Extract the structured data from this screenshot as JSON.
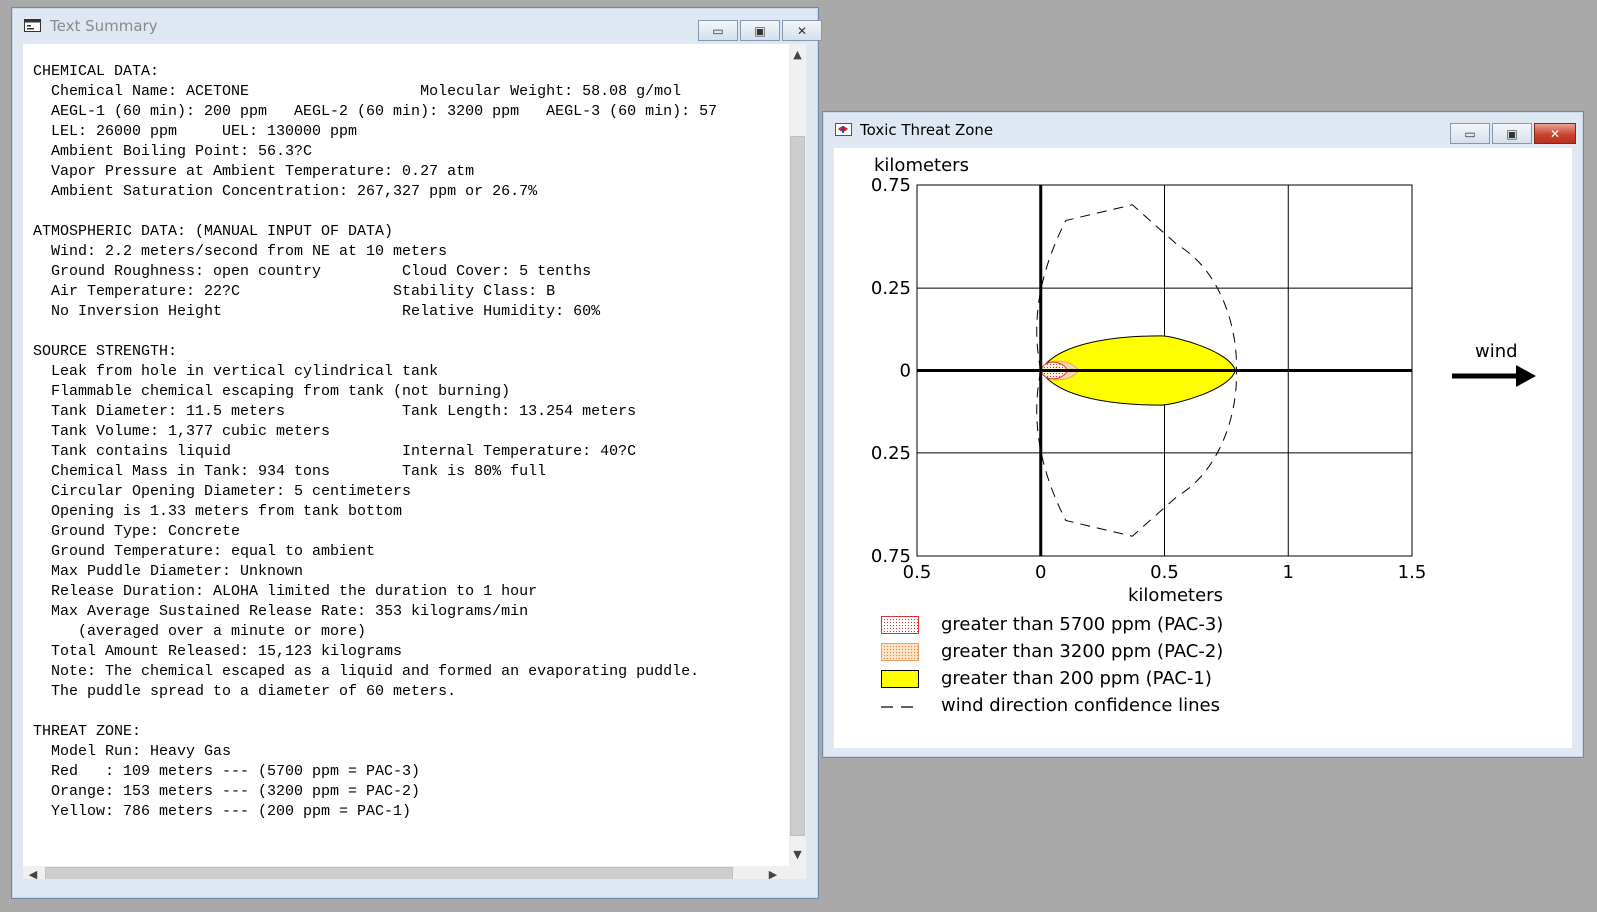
{
  "text_window": {
    "title": "Text Summary",
    "lines": [
      "CHEMICAL DATA:",
      "  Chemical Name: ACETONE                   Molecular Weight: 58.08 g/mol",
      "  AEGL-1 (60 min): 200 ppm   AEGL-2 (60 min): 3200 ppm   AEGL-3 (60 min): 57",
      "  LEL: 26000 ppm     UEL: 130000 ppm",
      "  Ambient Boiling Point: 56.3?C",
      "  Vapor Pressure at Ambient Temperature: 0.27 atm",
      "  Ambient Saturation Concentration: 267,327 ppm or 26.7%",
      "",
      "ATMOSPHERIC DATA: (MANUAL INPUT OF DATA)",
      "  Wind: 2.2 meters/second from NE at 10 meters",
      "  Ground Roughness: open country         Cloud Cover: 5 tenths",
      "  Air Temperature: 22?C                 Stability Class: B",
      "  No Inversion Height                    Relative Humidity: 60%",
      "",
      "SOURCE STRENGTH:",
      "  Leak from hole in vertical cylindrical tank",
      "  Flammable chemical escaping from tank (not burning)",
      "  Tank Diameter: 11.5 meters             Tank Length: 13.254 meters",
      "  Tank Volume: 1,377 cubic meters",
      "  Tank contains liquid                   Internal Temperature: 40?C",
      "  Chemical Mass in Tank: 934 tons        Tank is 80% full",
      "  Circular Opening Diameter: 5 centimeters",
      "  Opening is 1.33 meters from tank bottom",
      "  Ground Type: Concrete",
      "  Ground Temperature: equal to ambient",
      "  Max Puddle Diameter: Unknown",
      "  Release Duration: ALOHA limited the duration to 1 hour",
      "  Max Average Sustained Release Rate: 353 kilograms/min",
      "     (averaged over a minute or more)",
      "  Total Amount Released: 15,123 kilograms",
      "  Note: The chemical escaped as a liquid and formed an evaporating puddle.",
      "  The puddle spread to a diameter of 60 meters.",
      "",
      "THREAT ZONE:",
      "  Model Run: Heavy Gas",
      "  Red   : 109 meters --- (5700 ppm = PAC-3)",
      "  Orange: 153 meters --- (3200 ppm = PAC-2)",
      "  Yellow: 786 meters --- (200 ppm = PAC-1)"
    ]
  },
  "plot_window": {
    "title": "Toxic Threat Zone",
    "wind_label": "wind",
    "legend": [
      {
        "label": "greater than 5700 ppm (PAC-3)",
        "color": "#e03030"
      },
      {
        "label": "greater than 3200 ppm (PAC-2)",
        "color": "#f0a060"
      },
      {
        "label": "greater than 200 ppm (PAC-1)",
        "color": "#ffff00"
      },
      {
        "label": "wind direction confidence lines",
        "color": "#000000"
      }
    ]
  },
  "chart_data": {
    "type": "area",
    "xlabel": "kilometers",
    "ylabel": "kilometers",
    "x_ticks": [
      "0.5",
      "0",
      "0.5",
      "1",
      "1.5"
    ],
    "y_ticks": [
      "0.75",
      "0.25",
      "0",
      "0.25",
      "0.75"
    ],
    "xlim": [
      -0.5,
      1.5
    ],
    "ylim": [
      -0.75,
      0.75
    ],
    "grid": true,
    "zones": [
      {
        "name": "PAC-1",
        "threshold_ppm": 200,
        "max_downwind_km": 0.786,
        "max_halfwidth_km": 0.14,
        "color": "#ffff00"
      },
      {
        "name": "PAC-2",
        "threshold_ppm": 3200,
        "max_downwind_km": 0.153,
        "max_halfwidth_km": 0.05,
        "color": "#f0a060"
      },
      {
        "name": "PAC-3",
        "threshold_ppm": 5700,
        "max_downwind_km": 0.109,
        "max_halfwidth_km": 0.045,
        "color": "#e03030"
      }
    ],
    "confidence_lines": {
      "style": "dashed",
      "max_downwind_km": 0.79,
      "max_halfwidth_km": 0.67
    }
  }
}
